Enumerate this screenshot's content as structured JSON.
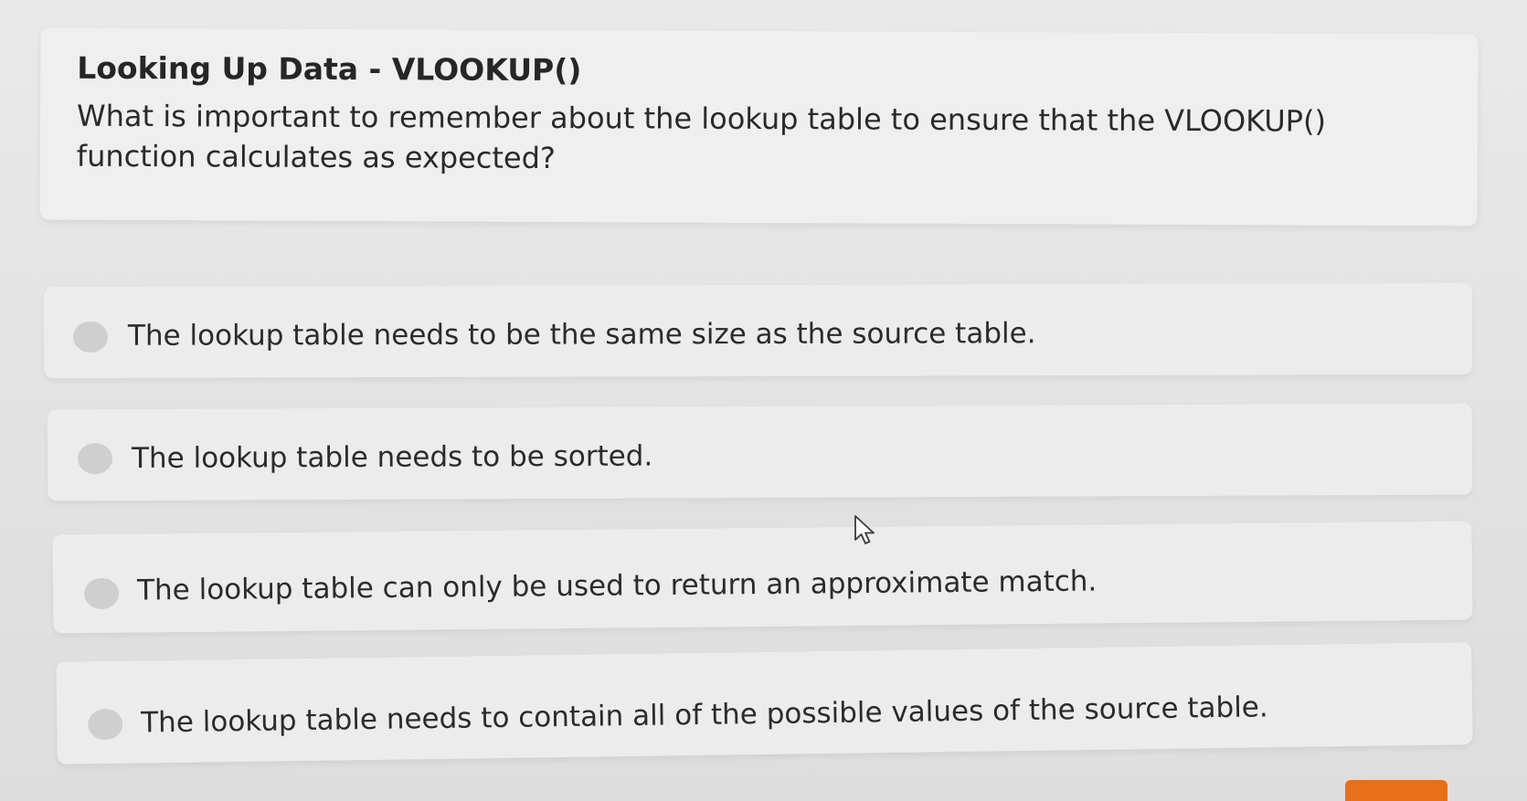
{
  "question": {
    "title": "Looking Up Data - VLOOKUP()",
    "text": "What is important to remember about the lookup table to ensure that the VLOOKUP() function calculates as expected?"
  },
  "options": [
    {
      "label": "The lookup table needs to be the same size as the source table.",
      "selected": false
    },
    {
      "label": "The lookup table needs to be sorted.",
      "selected": false
    },
    {
      "label": "The lookup table can only be used to return an approximate match.",
      "selected": false
    },
    {
      "label": "The lookup table needs to contain all of the possible values of the source table.",
      "selected": false
    }
  ],
  "colors": {
    "accent_button": "#e8701a",
    "radio_unselected": "#cfcfcf",
    "card_background": "#efefef"
  },
  "icons": {
    "cursor": "mouse-pointer-icon"
  }
}
